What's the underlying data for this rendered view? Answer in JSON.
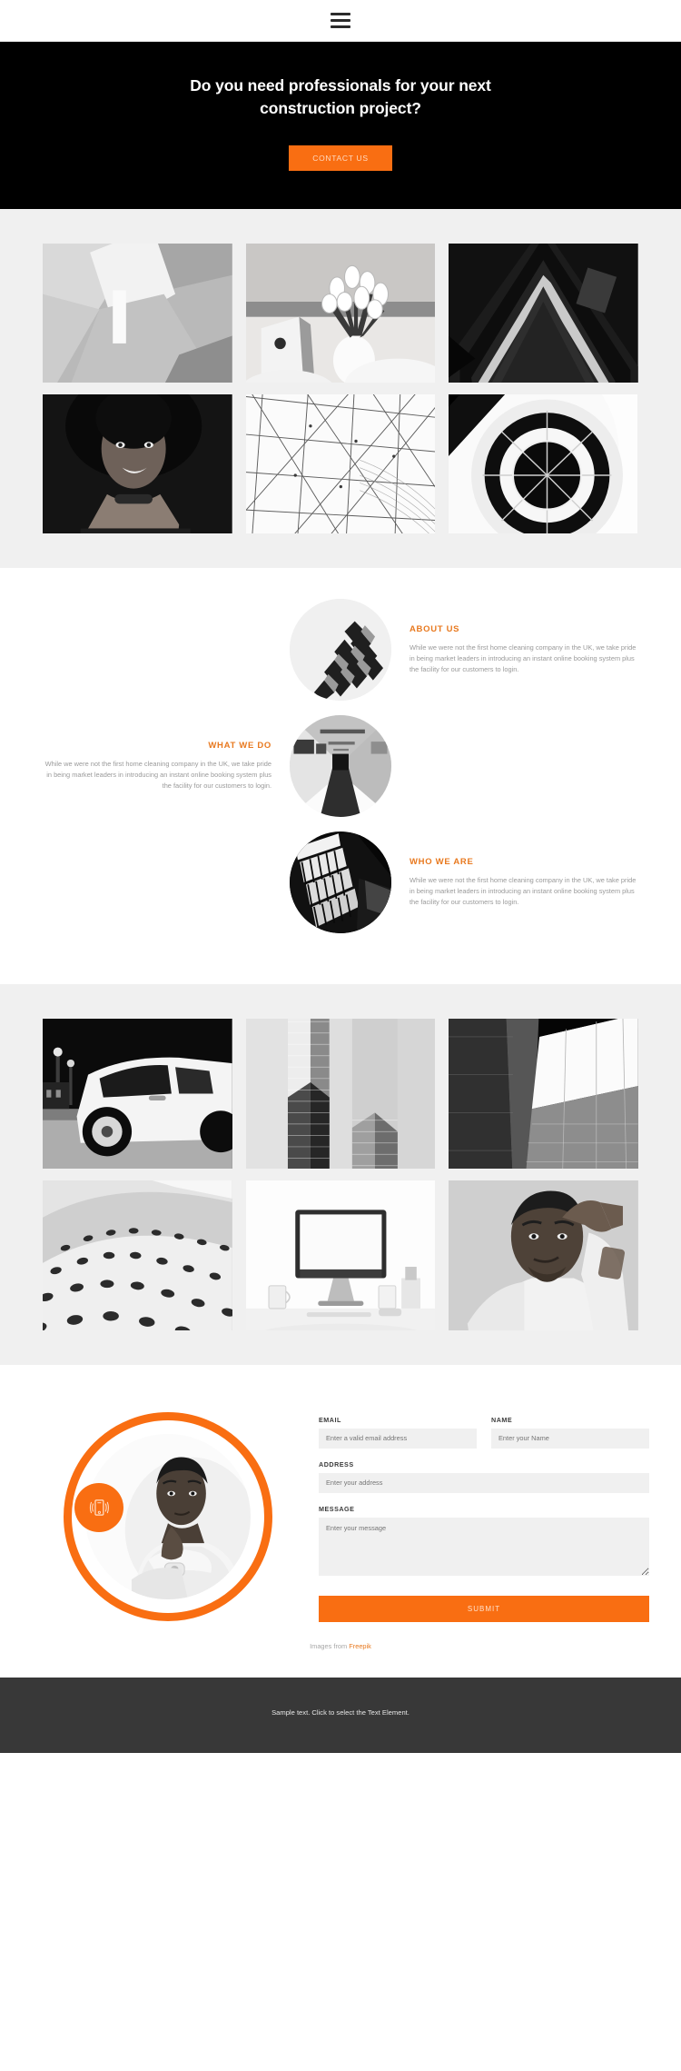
{
  "nav": {
    "menu_icon": "hamburger-menu-icon"
  },
  "hero": {
    "heading": "Do you need professionals for your next construction project?",
    "cta_label": "CONTACT US",
    "background_color": "#000000",
    "accent_color": "#f96e12"
  },
  "gallery_top": {
    "background_color": "#f0f0f0",
    "items": [
      {
        "alt": "abstract white geometric shapes"
      },
      {
        "alt": "laptop and white tulips on bed"
      },
      {
        "alt": "dark architectural roof peak"
      },
      {
        "alt": "smiling woman portrait"
      },
      {
        "alt": "white geometric wire lattice"
      },
      {
        "alt": "white spiral staircase from above"
      }
    ]
  },
  "features": [
    {
      "title": "ABOUT US",
      "body": "While we were not the first home cleaning company in the UK, we take pride in being market leaders in introducing an instant online booking system plus the facility for our customers to login.",
      "align": "right",
      "image_alt": "black and white angular facade pattern"
    },
    {
      "title": "WHAT WE DO",
      "body": "While we were not the first home cleaning company in the UK, we take pride in being market leaders in introducing an instant online booking system plus the facility for our customers to login.",
      "align": "left",
      "image_alt": "long perspective corridor interior"
    },
    {
      "title": "WHO WE ARE",
      "body": "While we were not the first home cleaning company in the UK, we take pride in being market leaders in introducing an instant online booking system plus the facility for our customers to login.",
      "align": "right",
      "image_alt": "striped building facade diagonal"
    }
  ],
  "gallery_bottom": {
    "background_color": "#f0f0f0",
    "items": [
      {
        "alt": "white sports car at night"
      },
      {
        "alt": "brick skyscraper corner"
      },
      {
        "alt": "bright skylight in dark building"
      },
      {
        "alt": "textured honeycomb wave surface"
      },
      {
        "alt": "desktop computer on white desk"
      },
      {
        "alt": "man with hand on head"
      }
    ]
  },
  "contact": {
    "photo_alt": "man in white shirt with arms crossed",
    "badge_icon": "ringing-phone-icon",
    "ring_color": "#f96e12",
    "fields": {
      "email": {
        "label": "EMAIL",
        "placeholder": "Enter a valid email address",
        "value": ""
      },
      "name": {
        "label": "NAME",
        "placeholder": "Enter your Name",
        "value": ""
      },
      "address": {
        "label": "ADDRESS",
        "placeholder": "Enter your address",
        "value": ""
      },
      "message": {
        "label": "MESSAGE",
        "placeholder": "Enter your message",
        "value": ""
      }
    },
    "submit_label": "SUBMIT",
    "credit_prefix": "Images from ",
    "credit_link": "Freepik"
  },
  "footer": {
    "text": "Sample text. Click to select the Text Element.",
    "background_color": "#383838"
  }
}
